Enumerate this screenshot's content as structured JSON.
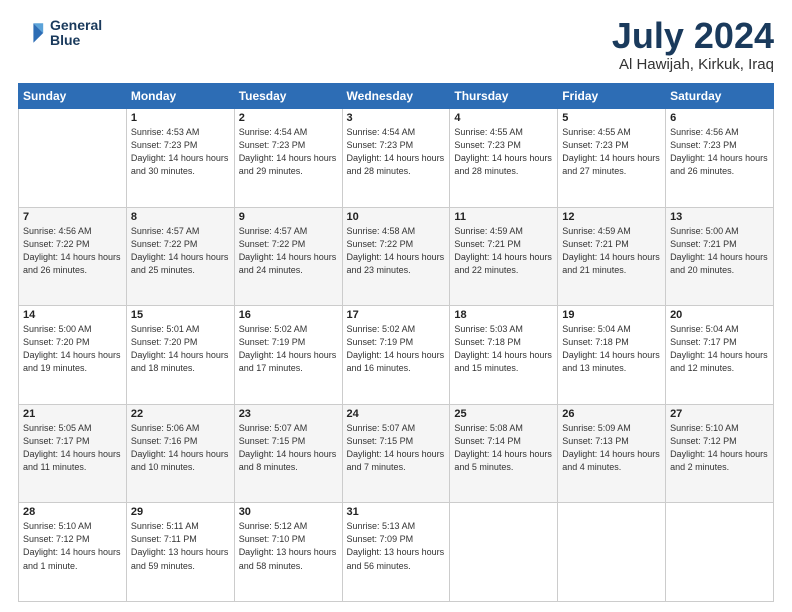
{
  "header": {
    "logo_line1": "General",
    "logo_line2": "Blue",
    "month": "July 2024",
    "location": "Al Hawijah, Kirkuk, Iraq"
  },
  "weekdays": [
    "Sunday",
    "Monday",
    "Tuesday",
    "Wednesday",
    "Thursday",
    "Friday",
    "Saturday"
  ],
  "weeks": [
    [
      {
        "day": null
      },
      {
        "day": "1",
        "sunrise": "4:53 AM",
        "sunset": "7:23 PM",
        "daylight": "14 hours and 30 minutes."
      },
      {
        "day": "2",
        "sunrise": "4:54 AM",
        "sunset": "7:23 PM",
        "daylight": "14 hours and 29 minutes."
      },
      {
        "day": "3",
        "sunrise": "4:54 AM",
        "sunset": "7:23 PM",
        "daylight": "14 hours and 28 minutes."
      },
      {
        "day": "4",
        "sunrise": "4:55 AM",
        "sunset": "7:23 PM",
        "daylight": "14 hours and 28 minutes."
      },
      {
        "day": "5",
        "sunrise": "4:55 AM",
        "sunset": "7:23 PM",
        "daylight": "14 hours and 27 minutes."
      },
      {
        "day": "6",
        "sunrise": "4:56 AM",
        "sunset": "7:23 PM",
        "daylight": "14 hours and 26 minutes."
      }
    ],
    [
      {
        "day": "7",
        "sunrise": "4:56 AM",
        "sunset": "7:22 PM",
        "daylight": "14 hours and 26 minutes."
      },
      {
        "day": "8",
        "sunrise": "4:57 AM",
        "sunset": "7:22 PM",
        "daylight": "14 hours and 25 minutes."
      },
      {
        "day": "9",
        "sunrise": "4:57 AM",
        "sunset": "7:22 PM",
        "daylight": "14 hours and 24 minutes."
      },
      {
        "day": "10",
        "sunrise": "4:58 AM",
        "sunset": "7:22 PM",
        "daylight": "14 hours and 23 minutes."
      },
      {
        "day": "11",
        "sunrise": "4:59 AM",
        "sunset": "7:21 PM",
        "daylight": "14 hours and 22 minutes."
      },
      {
        "day": "12",
        "sunrise": "4:59 AM",
        "sunset": "7:21 PM",
        "daylight": "14 hours and 21 minutes."
      },
      {
        "day": "13",
        "sunrise": "5:00 AM",
        "sunset": "7:21 PM",
        "daylight": "14 hours and 20 minutes."
      }
    ],
    [
      {
        "day": "14",
        "sunrise": "5:00 AM",
        "sunset": "7:20 PM",
        "daylight": "14 hours and 19 minutes."
      },
      {
        "day": "15",
        "sunrise": "5:01 AM",
        "sunset": "7:20 PM",
        "daylight": "14 hours and 18 minutes."
      },
      {
        "day": "16",
        "sunrise": "5:02 AM",
        "sunset": "7:19 PM",
        "daylight": "14 hours and 17 minutes."
      },
      {
        "day": "17",
        "sunrise": "5:02 AM",
        "sunset": "7:19 PM",
        "daylight": "14 hours and 16 minutes."
      },
      {
        "day": "18",
        "sunrise": "5:03 AM",
        "sunset": "7:18 PM",
        "daylight": "14 hours and 15 minutes."
      },
      {
        "day": "19",
        "sunrise": "5:04 AM",
        "sunset": "7:18 PM",
        "daylight": "14 hours and 13 minutes."
      },
      {
        "day": "20",
        "sunrise": "5:04 AM",
        "sunset": "7:17 PM",
        "daylight": "14 hours and 12 minutes."
      }
    ],
    [
      {
        "day": "21",
        "sunrise": "5:05 AM",
        "sunset": "7:17 PM",
        "daylight": "14 hours and 11 minutes."
      },
      {
        "day": "22",
        "sunrise": "5:06 AM",
        "sunset": "7:16 PM",
        "daylight": "14 hours and 10 minutes."
      },
      {
        "day": "23",
        "sunrise": "5:07 AM",
        "sunset": "7:15 PM",
        "daylight": "14 hours and 8 minutes."
      },
      {
        "day": "24",
        "sunrise": "5:07 AM",
        "sunset": "7:15 PM",
        "daylight": "14 hours and 7 minutes."
      },
      {
        "day": "25",
        "sunrise": "5:08 AM",
        "sunset": "7:14 PM",
        "daylight": "14 hours and 5 minutes."
      },
      {
        "day": "26",
        "sunrise": "5:09 AM",
        "sunset": "7:13 PM",
        "daylight": "14 hours and 4 minutes."
      },
      {
        "day": "27",
        "sunrise": "5:10 AM",
        "sunset": "7:12 PM",
        "daylight": "14 hours and 2 minutes."
      }
    ],
    [
      {
        "day": "28",
        "sunrise": "5:10 AM",
        "sunset": "7:12 PM",
        "daylight": "14 hours and 1 minute."
      },
      {
        "day": "29",
        "sunrise": "5:11 AM",
        "sunset": "7:11 PM",
        "daylight": "13 hours and 59 minutes."
      },
      {
        "day": "30",
        "sunrise": "5:12 AM",
        "sunset": "7:10 PM",
        "daylight": "13 hours and 58 minutes."
      },
      {
        "day": "31",
        "sunrise": "5:13 AM",
        "sunset": "7:09 PM",
        "daylight": "13 hours and 56 minutes."
      },
      {
        "day": null
      },
      {
        "day": null
      },
      {
        "day": null
      }
    ]
  ]
}
